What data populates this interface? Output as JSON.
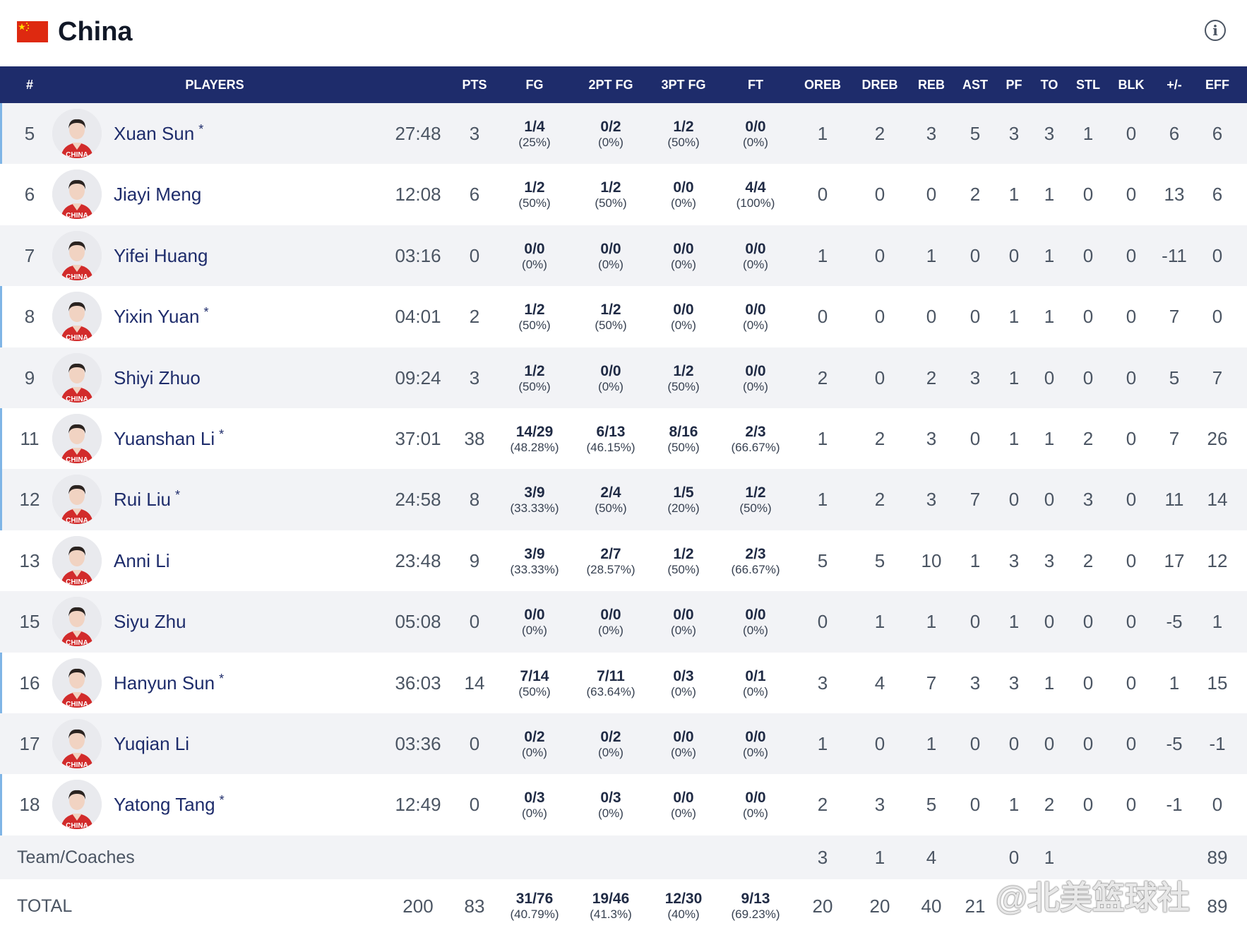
{
  "team": {
    "name": "China",
    "flag_icon": "china-flag-icon",
    "info_icon": "info-icon"
  },
  "columns": [
    "#",
    "PLAYERS",
    "PTS",
    "FG",
    "2PT FG",
    "3PT FG",
    "FT",
    "OREB",
    "DREB",
    "REB",
    "AST",
    "PF",
    "TO",
    "STL",
    "BLK",
    "+/-",
    "EFF"
  ],
  "players": [
    {
      "num": "5",
      "name": "Xuan Sun",
      "starter": true,
      "min": "27:48",
      "pts": "3",
      "fg": "1/4",
      "fg_pct": "(25%)",
      "fg2": "0/2",
      "fg2_pct": "(0%)",
      "fg3": "1/2",
      "fg3_pct": "(50%)",
      "ft": "0/0",
      "ft_pct": "(0%)",
      "oreb": "1",
      "dreb": "2",
      "reb": "3",
      "ast": "5",
      "pf": "3",
      "to": "3",
      "stl": "1",
      "blk": "0",
      "pm": "6",
      "eff": "6"
    },
    {
      "num": "6",
      "name": "Jiayi Meng",
      "starter": false,
      "min": "12:08",
      "pts": "6",
      "fg": "1/2",
      "fg_pct": "(50%)",
      "fg2": "1/2",
      "fg2_pct": "(50%)",
      "fg3": "0/0",
      "fg3_pct": "(0%)",
      "ft": "4/4",
      "ft_pct": "(100%)",
      "oreb": "0",
      "dreb": "0",
      "reb": "0",
      "ast": "2",
      "pf": "1",
      "to": "1",
      "stl": "0",
      "blk": "0",
      "pm": "13",
      "eff": "6"
    },
    {
      "num": "7",
      "name": "Yifei Huang",
      "starter": false,
      "min": "03:16",
      "pts": "0",
      "fg": "0/0",
      "fg_pct": "(0%)",
      "fg2": "0/0",
      "fg2_pct": "(0%)",
      "fg3": "0/0",
      "fg3_pct": "(0%)",
      "ft": "0/0",
      "ft_pct": "(0%)",
      "oreb": "1",
      "dreb": "0",
      "reb": "1",
      "ast": "0",
      "pf": "0",
      "to": "1",
      "stl": "0",
      "blk": "0",
      "pm": "-11",
      "eff": "0"
    },
    {
      "num": "8",
      "name": "Yixin Yuan",
      "starter": true,
      "min": "04:01",
      "pts": "2",
      "fg": "1/2",
      "fg_pct": "(50%)",
      "fg2": "1/2",
      "fg2_pct": "(50%)",
      "fg3": "0/0",
      "fg3_pct": "(0%)",
      "ft": "0/0",
      "ft_pct": "(0%)",
      "oreb": "0",
      "dreb": "0",
      "reb": "0",
      "ast": "0",
      "pf": "1",
      "to": "1",
      "stl": "0",
      "blk": "0",
      "pm": "7",
      "eff": "0"
    },
    {
      "num": "9",
      "name": "Shiyi Zhuo",
      "starter": false,
      "min": "09:24",
      "pts": "3",
      "fg": "1/2",
      "fg_pct": "(50%)",
      "fg2": "0/0",
      "fg2_pct": "(0%)",
      "fg3": "1/2",
      "fg3_pct": "(50%)",
      "ft": "0/0",
      "ft_pct": "(0%)",
      "oreb": "2",
      "dreb": "0",
      "reb": "2",
      "ast": "3",
      "pf": "1",
      "to": "0",
      "stl": "0",
      "blk": "0",
      "pm": "5",
      "eff": "7"
    },
    {
      "num": "11",
      "name": "Yuanshan Li",
      "starter": true,
      "min": "37:01",
      "pts": "38",
      "fg": "14/29",
      "fg_pct": "(48.28%)",
      "fg2": "6/13",
      "fg2_pct": "(46.15%)",
      "fg3": "8/16",
      "fg3_pct": "(50%)",
      "ft": "2/3",
      "ft_pct": "(66.67%)",
      "oreb": "1",
      "dreb": "2",
      "reb": "3",
      "ast": "0",
      "pf": "1",
      "to": "1",
      "stl": "2",
      "blk": "0",
      "pm": "7",
      "eff": "26"
    },
    {
      "num": "12",
      "name": "Rui Liu",
      "starter": true,
      "min": "24:58",
      "pts": "8",
      "fg": "3/9",
      "fg_pct": "(33.33%)",
      "fg2": "2/4",
      "fg2_pct": "(50%)",
      "fg3": "1/5",
      "fg3_pct": "(20%)",
      "ft": "1/2",
      "ft_pct": "(50%)",
      "oreb": "1",
      "dreb": "2",
      "reb": "3",
      "ast": "7",
      "pf": "0",
      "to": "0",
      "stl": "3",
      "blk": "0",
      "pm": "11",
      "eff": "14"
    },
    {
      "num": "13",
      "name": "Anni Li",
      "starter": false,
      "min": "23:48",
      "pts": "9",
      "fg": "3/9",
      "fg_pct": "(33.33%)",
      "fg2": "2/7",
      "fg2_pct": "(28.57%)",
      "fg3": "1/2",
      "fg3_pct": "(50%)",
      "ft": "2/3",
      "ft_pct": "(66.67%)",
      "oreb": "5",
      "dreb": "5",
      "reb": "10",
      "ast": "1",
      "pf": "3",
      "to": "3",
      "stl": "2",
      "blk": "0",
      "pm": "17",
      "eff": "12"
    },
    {
      "num": "15",
      "name": "Siyu Zhu",
      "starter": false,
      "min": "05:08",
      "pts": "0",
      "fg": "0/0",
      "fg_pct": "(0%)",
      "fg2": "0/0",
      "fg2_pct": "(0%)",
      "fg3": "0/0",
      "fg3_pct": "(0%)",
      "ft": "0/0",
      "ft_pct": "(0%)",
      "oreb": "0",
      "dreb": "1",
      "reb": "1",
      "ast": "0",
      "pf": "1",
      "to": "0",
      "stl": "0",
      "blk": "0",
      "pm": "-5",
      "eff": "1"
    },
    {
      "num": "16",
      "name": "Hanyun Sun",
      "starter": true,
      "min": "36:03",
      "pts": "14",
      "fg": "7/14",
      "fg_pct": "(50%)",
      "fg2": "7/11",
      "fg2_pct": "(63.64%)",
      "fg3": "0/3",
      "fg3_pct": "(0%)",
      "ft": "0/1",
      "ft_pct": "(0%)",
      "oreb": "3",
      "dreb": "4",
      "reb": "7",
      "ast": "3",
      "pf": "3",
      "to": "1",
      "stl": "0",
      "blk": "0",
      "pm": "1",
      "eff": "15"
    },
    {
      "num": "17",
      "name": "Yuqian Li",
      "starter": false,
      "min": "03:36",
      "pts": "0",
      "fg": "0/2",
      "fg_pct": "(0%)",
      "fg2": "0/2",
      "fg2_pct": "(0%)",
      "fg3": "0/0",
      "fg3_pct": "(0%)",
      "ft": "0/0",
      "ft_pct": "(0%)",
      "oreb": "1",
      "dreb": "0",
      "reb": "1",
      "ast": "0",
      "pf": "0",
      "to": "0",
      "stl": "0",
      "blk": "0",
      "pm": "-5",
      "eff": "-1"
    },
    {
      "num": "18",
      "name": "Yatong Tang",
      "starter": true,
      "min": "12:49",
      "pts": "0",
      "fg": "0/3",
      "fg_pct": "(0%)",
      "fg2": "0/3",
      "fg2_pct": "(0%)",
      "fg3": "0/0",
      "fg3_pct": "(0%)",
      "ft": "0/0",
      "ft_pct": "(0%)",
      "oreb": "2",
      "dreb": "3",
      "reb": "5",
      "ast": "0",
      "pf": "1",
      "to": "2",
      "stl": "0",
      "blk": "0",
      "pm": "-1",
      "eff": "0"
    }
  ],
  "starter_mark": "*",
  "team_coaches": {
    "label": "Team/Coaches",
    "oreb": "3",
    "dreb": "1",
    "reb": "4",
    "pf": "0",
    "to": "1",
    "eff": "89"
  },
  "total": {
    "label": "TOTAL",
    "min": "200",
    "pts": "83",
    "fg": "31/76",
    "fg_pct": "(40.79%)",
    "fg2": "19/46",
    "fg2_pct": "(41.3%)",
    "fg3": "12/30",
    "fg3_pct": "(40%)",
    "ft": "9/13",
    "ft_pct": "(69.23%)",
    "oreb": "20",
    "dreb": "20",
    "reb": "40",
    "ast": "21",
    "eff": "89"
  },
  "watermark": "@北美篮球社",
  "jersey_text": "CHINA",
  "colors": {
    "header_bg": "#1e2c6b",
    "starter_bar": "#7fb5e6",
    "row_alt": "#f2f3f6",
    "name_color": "#1e2c6b",
    "flag_red": "#de2910"
  }
}
